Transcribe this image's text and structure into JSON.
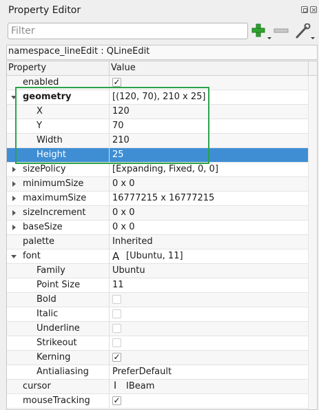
{
  "panel": {
    "title": "Property Editor"
  },
  "filter": {
    "placeholder": "Filter",
    "value": ""
  },
  "toolbar": {
    "add_icon": "plus-icon",
    "remove_icon": "minus-icon",
    "tool_icon": "wrench-icon"
  },
  "class_bar": {
    "text": "namespace_lineEdit : QLineEdit"
  },
  "table": {
    "headers": {
      "property": "Property",
      "value": "Value"
    },
    "rows": [
      {
        "id": "enabled",
        "label": "enabled",
        "value": "",
        "checked": true
      },
      {
        "id": "geometry",
        "label": "geometry",
        "value": "[(120, 70), 210 x 25]",
        "expanded": true
      },
      {
        "id": "geometry-x",
        "label": "X",
        "value": "120"
      },
      {
        "id": "geometry-y",
        "label": "Y",
        "value": "70"
      },
      {
        "id": "geometry-width",
        "label": "Width",
        "value": "210"
      },
      {
        "id": "geometry-height",
        "label": "Height",
        "value": "25",
        "selected": true
      },
      {
        "id": "sizepolicy",
        "label": "sizePolicy",
        "value": "[Expanding, Fixed, 0, 0]"
      },
      {
        "id": "minimumsize",
        "label": "minimumSize",
        "value": "0 x 0"
      },
      {
        "id": "maximumsize",
        "label": "maximumSize",
        "value": "16777215 x 16777215"
      },
      {
        "id": "sizeincrement",
        "label": "sizeIncrement",
        "value": "0 x 0"
      },
      {
        "id": "basesize",
        "label": "baseSize",
        "value": "0 x 0"
      },
      {
        "id": "palette",
        "label": "palette",
        "value": "Inherited"
      },
      {
        "id": "font",
        "label": "font",
        "value": "[Ubuntu, 11]",
        "expanded": true,
        "icon_glyph": "A"
      },
      {
        "id": "font-family",
        "label": "Family",
        "value": "Ubuntu"
      },
      {
        "id": "font-pointsize",
        "label": "Point Size",
        "value": "11"
      },
      {
        "id": "font-bold",
        "label": "Bold",
        "checked": false
      },
      {
        "id": "font-italic",
        "label": "Italic",
        "checked": false
      },
      {
        "id": "font-underline",
        "label": "Underline",
        "checked": false
      },
      {
        "id": "font-strikeout",
        "label": "Strikeout",
        "checked": false
      },
      {
        "id": "font-kerning",
        "label": "Kerning",
        "checked": true
      },
      {
        "id": "font-antialiasing",
        "label": "Antialiasing",
        "value": "PreferDefault"
      },
      {
        "id": "cursor",
        "label": "cursor",
        "value": "IBeam",
        "icon_glyph": "I"
      },
      {
        "id": "mousetracking",
        "label": "mouseTracking",
        "checked": true
      }
    ]
  },
  "colors": {
    "selection": "#3f8ed4",
    "highlight_box": "#2aa34a",
    "add_icon": "#2fa32f"
  }
}
